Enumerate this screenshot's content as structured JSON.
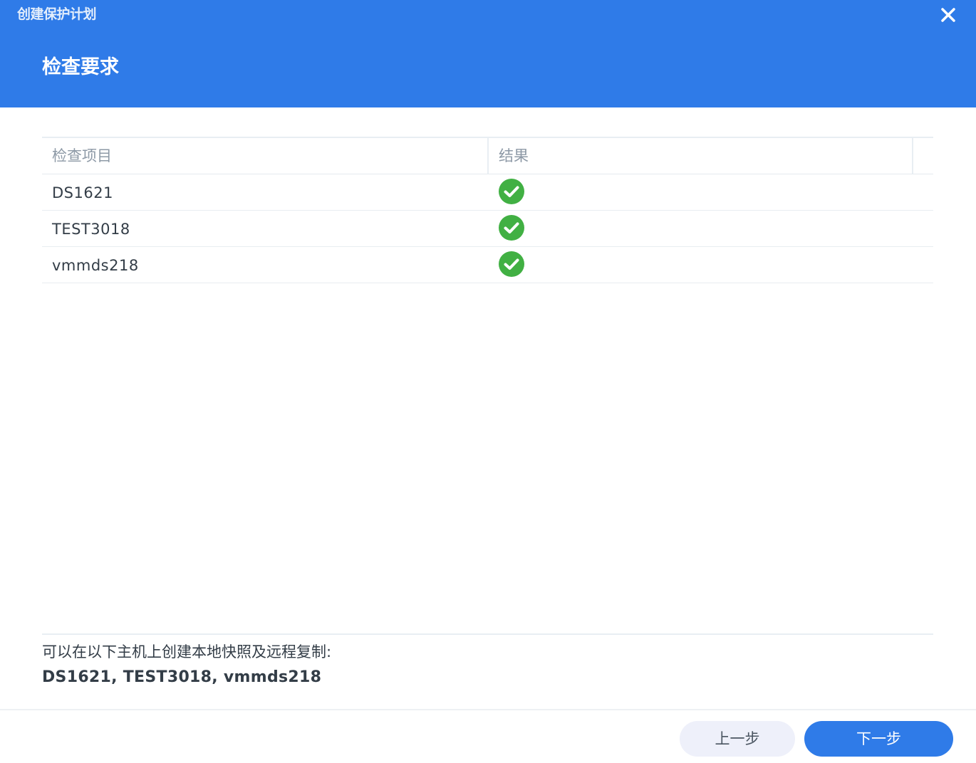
{
  "window": {
    "title": "创建保护计划",
    "close_icon": "close-icon"
  },
  "header": {
    "title": "检查要求",
    "background_color": "#2f7be8"
  },
  "table": {
    "columns": [
      "检查项目",
      "结果"
    ],
    "rows": [
      {
        "name": "DS1621",
        "result": "check-circle-icon",
        "status": "success"
      },
      {
        "name": "TEST3018",
        "result": "check-circle-icon",
        "status": "success"
      },
      {
        "name": "vmmds218",
        "result": "check-circle-icon",
        "status": "success"
      }
    ],
    "success_color": "#41b043"
  },
  "info": {
    "label": "可以在以下主机上创建本地快照及远程复制:",
    "hosts": "DS1621, TEST3018, vmmds218"
  },
  "footer": {
    "back_label": "上一步",
    "next_label": "下一步",
    "accent_color": "#2f7be8"
  }
}
